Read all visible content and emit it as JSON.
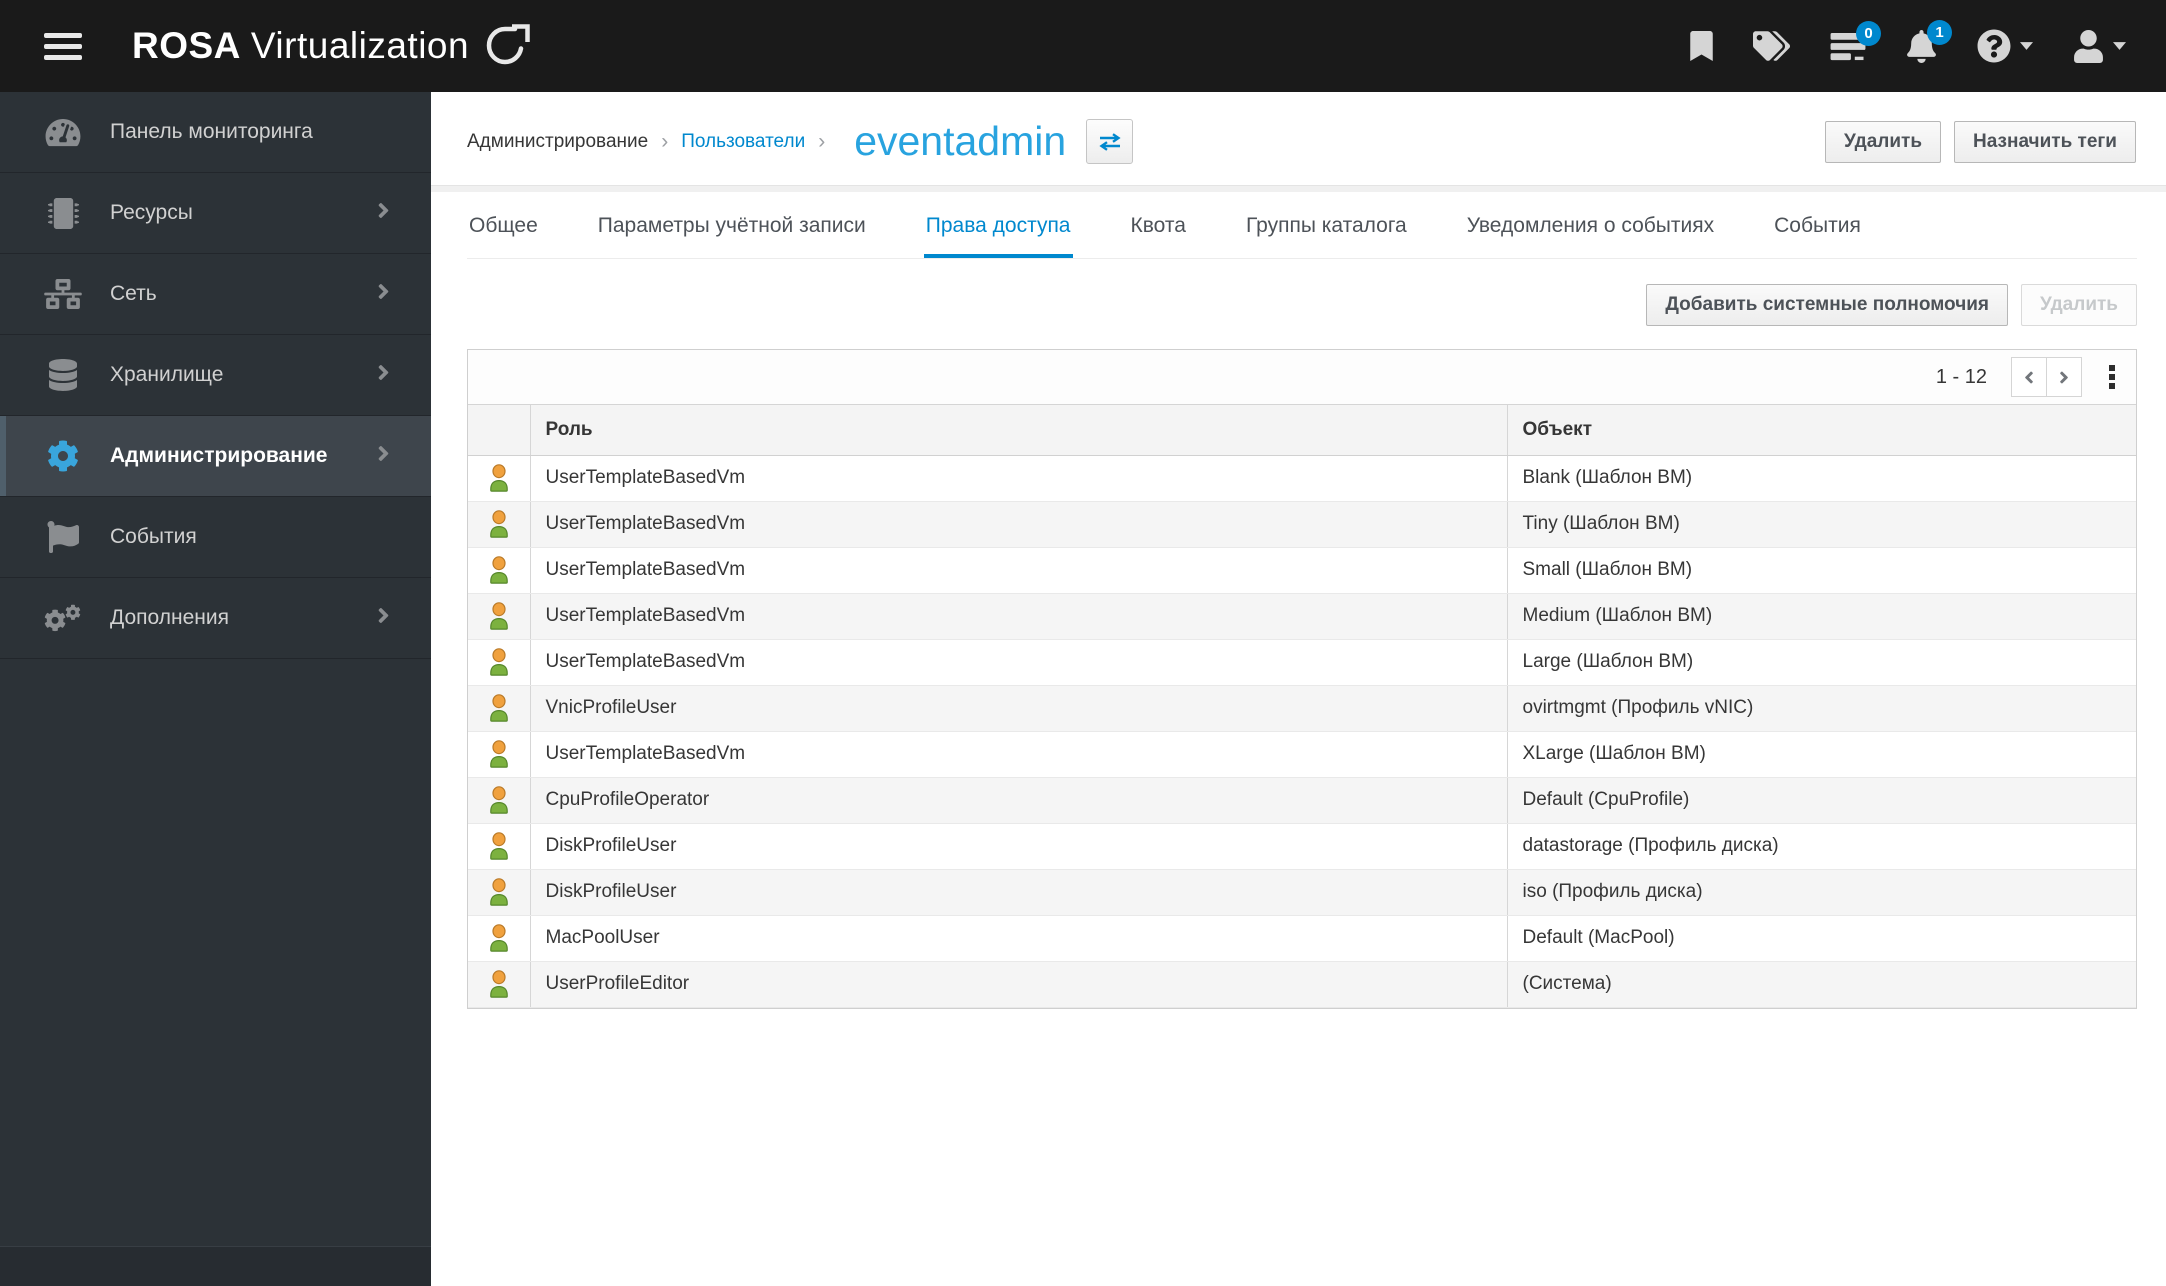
{
  "app": {
    "brand_bold": "ROSA",
    "brand_rest": "Virtualization"
  },
  "masthead": {
    "tasks_badge": "0",
    "notifications_badge": "1"
  },
  "sidebar": {
    "items": [
      {
        "id": "dashboard",
        "label": "Панель мониторинга",
        "icon": "dashboard-icon",
        "chevron": false,
        "active": false
      },
      {
        "id": "resources",
        "label": "Ресурсы",
        "icon": "resources-chip-icon",
        "chevron": true,
        "active": false
      },
      {
        "id": "network",
        "label": "Сеть",
        "icon": "network-icon",
        "chevron": true,
        "active": false
      },
      {
        "id": "storage",
        "label": "Хранилище",
        "icon": "storage-database-icon",
        "chevron": true,
        "active": false
      },
      {
        "id": "administration",
        "label": "Администрирование",
        "icon": "administration-gear-icon",
        "chevron": true,
        "active": true
      },
      {
        "id": "events",
        "label": "События",
        "icon": "events-flag-icon",
        "chevron": false,
        "active": false
      },
      {
        "id": "addons",
        "label": "Дополнения",
        "icon": "addons-gears-icon",
        "chevron": true,
        "active": false
      }
    ]
  },
  "breadcrumb": {
    "root": "Администрирование",
    "parent_link": "Пользователи",
    "current": "eventadmin"
  },
  "page_actions": {
    "delete_label": "Удалить",
    "assign_tags_label": "Назначить теги"
  },
  "tabs": [
    {
      "id": "general",
      "label": "Общее",
      "active": false
    },
    {
      "id": "account-settings",
      "label": "Параметры учётной записи",
      "active": false
    },
    {
      "id": "permissions",
      "label": "Права доступа",
      "active": true
    },
    {
      "id": "quota",
      "label": "Квота",
      "active": false
    },
    {
      "id": "directory-groups",
      "label": "Группы каталога",
      "active": false
    },
    {
      "id": "event-notifications",
      "label": "Уведомления о событиях",
      "active": false
    },
    {
      "id": "events",
      "label": "События",
      "active": false
    }
  ],
  "toolbar": {
    "add_system_permission_label": "Добавить системные полномочия",
    "remove_label": "Удалить",
    "remove_disabled": true
  },
  "table": {
    "pagination_range": "1 - 12",
    "columns": {
      "role": "Роль",
      "object": "Объект"
    },
    "rows": [
      {
        "role": "UserTemplateBasedVm",
        "object": "Blank (Шаблон ВМ)"
      },
      {
        "role": "UserTemplateBasedVm",
        "object": "Tiny (Шаблон ВМ)"
      },
      {
        "role": "UserTemplateBasedVm",
        "object": "Small (Шаблон ВМ)"
      },
      {
        "role": "UserTemplateBasedVm",
        "object": "Medium (Шаблон ВМ)"
      },
      {
        "role": "UserTemplateBasedVm",
        "object": "Large (Шаблон ВМ)"
      },
      {
        "role": "VnicProfileUser",
        "object": "ovirtmgmt (Профиль vNIC)"
      },
      {
        "role": "UserTemplateBasedVm",
        "object": "XLarge (Шаблон ВМ)"
      },
      {
        "role": "CpuProfileOperator",
        "object": "Default (CpuProfile)"
      },
      {
        "role": "DiskProfileUser",
        "object": "datastorage (Профиль диска)"
      },
      {
        "role": "DiskProfileUser",
        "object": "iso (Профиль диска)"
      },
      {
        "role": "MacPoolUser",
        "object": "Default (MacPool)"
      },
      {
        "role": "UserProfileEditor",
        "object": "(Система)"
      }
    ]
  },
  "colors": {
    "accent_link": "#0088ce",
    "title_blue": "#28a3df",
    "badge_blue": "#0088ce",
    "active_gear_blue": "#39a5dc"
  }
}
